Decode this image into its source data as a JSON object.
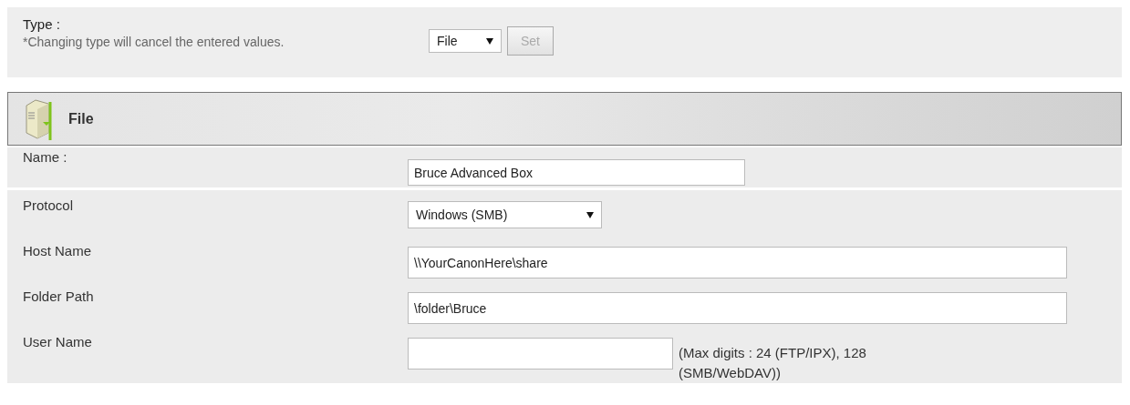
{
  "type_panel": {
    "label": "Type :",
    "note": "*Changing type will cancel the entered values.",
    "select_value": "File",
    "set_button": {
      "label": "Set",
      "disabled": true
    }
  },
  "section": {
    "title": "File"
  },
  "fields": [
    {
      "kind": "name",
      "label": "Name :",
      "value": "Bruce Advanced Box"
    },
    {
      "kind": "select",
      "label": "Protocol",
      "value": "Windows (SMB)"
    },
    {
      "kind": "path",
      "label": "Host Name",
      "value": "\\\\YourCanonHere\\share"
    },
    {
      "kind": "path",
      "label": "Folder Path",
      "value": "\\folder\\Bruce"
    },
    {
      "kind": "account",
      "label": "User Name",
      "hint": "(Max digits : 24 (FTP/IPX), 128 (SMB/WebDAV))"
    }
  ]
}
